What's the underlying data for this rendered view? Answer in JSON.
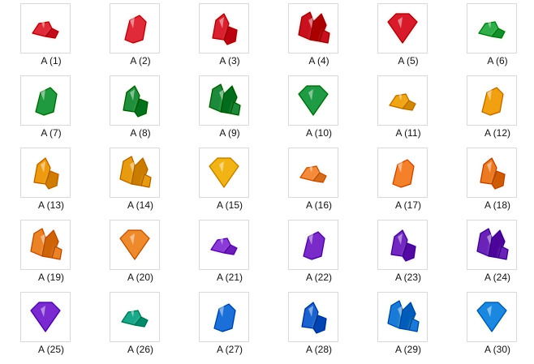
{
  "window": {
    "title": "",
    "background": "#ffffff"
  },
  "items": [
    {
      "label": "A (1)",
      "shape": "small-pair",
      "color": "#e02a3a",
      "glow": "#ff7a8a"
    },
    {
      "label": "A (2)",
      "shape": "shard",
      "color": "#e02a3a",
      "glow": "#ff7a8a"
    },
    {
      "label": "A (3)",
      "shape": "double",
      "color": "#d8202e",
      "glow": "#ff7a8a"
    },
    {
      "label": "A (4)",
      "shape": "cluster",
      "color": "#c8101e",
      "glow": "#ff6a7a"
    },
    {
      "label": "A (5)",
      "shape": "gem",
      "color": "#d81a2a",
      "glow": "#ff7a8a"
    },
    {
      "label": "A (6)",
      "shape": "small-pair",
      "color": "#2fae4a",
      "glow": "#8cff8c"
    },
    {
      "label": "A (7)",
      "shape": "shard",
      "color": "#1f9a3f",
      "glow": "#8cff8c"
    },
    {
      "label": "A (8)",
      "shape": "double",
      "color": "#1f8f3c",
      "glow": "#8cff8c"
    },
    {
      "label": "A (9)",
      "shape": "cluster",
      "color": "#1c8a3a",
      "glow": "#8cff8c"
    },
    {
      "label": "A (10)",
      "shape": "gem",
      "color": "#1f9a45",
      "glow": "#8cff8c"
    },
    {
      "label": "A (11)",
      "shape": "small-pair",
      "color": "#f0a514",
      "glow": "#ffe26a"
    },
    {
      "label": "A (12)",
      "shape": "shard",
      "color": "#f0a010",
      "glow": "#ffe26a"
    },
    {
      "label": "A (13)",
      "shape": "double",
      "color": "#ee9a10",
      "glow": "#ffe26a"
    },
    {
      "label": "A (14)",
      "shape": "cluster",
      "color": "#e89a10",
      "glow": "#ffe26a"
    },
    {
      "label": "A (15)",
      "shape": "gem",
      "color": "#f2b414",
      "glow": "#ffe26a"
    },
    {
      "label": "A (16)",
      "shape": "small-pair",
      "color": "#f58a3a",
      "glow": "#ffc59a"
    },
    {
      "label": "A (17)",
      "shape": "shard",
      "color": "#f5802a",
      "glow": "#ffc59a"
    },
    {
      "label": "A (18)",
      "shape": "double",
      "color": "#ec7a22",
      "glow": "#ffc59a"
    },
    {
      "label": "A (19)",
      "shape": "cluster",
      "color": "#ec8226",
      "glow": "#ffc59a"
    },
    {
      "label": "A (20)",
      "shape": "gem",
      "color": "#ef8a2c",
      "glow": "#ffc59a"
    },
    {
      "label": "A (21)",
      "shape": "small-pair",
      "color": "#8a3ad8",
      "glow": "#d59aff"
    },
    {
      "label": "A (22)",
      "shape": "shard",
      "color": "#7a2ac8",
      "glow": "#d59aff"
    },
    {
      "label": "A (23)",
      "shape": "double",
      "color": "#7228c0",
      "glow": "#d59aff"
    },
    {
      "label": "A (24)",
      "shape": "cluster",
      "color": "#6a22b8",
      "glow": "#d59aff"
    },
    {
      "label": "A (25)",
      "shape": "gem",
      "color": "#7a2ad0",
      "glow": "#d59aff"
    },
    {
      "label": "A (26)",
      "shape": "small-pair",
      "color": "#1aa88a",
      "glow": "#7affc8"
    },
    {
      "label": "A (27)",
      "shape": "shard",
      "color": "#1a70d8",
      "glow": "#7affb0"
    },
    {
      "label": "A (28)",
      "shape": "double",
      "color": "#1a62d0",
      "glow": "#8cff8c"
    },
    {
      "label": "A (29)",
      "shape": "cluster",
      "color": "#1a7ad8",
      "glow": "#8cff8c"
    },
    {
      "label": "A (30)",
      "shape": "gem",
      "color": "#1a88e0",
      "glow": "#8cff8c"
    }
  ]
}
